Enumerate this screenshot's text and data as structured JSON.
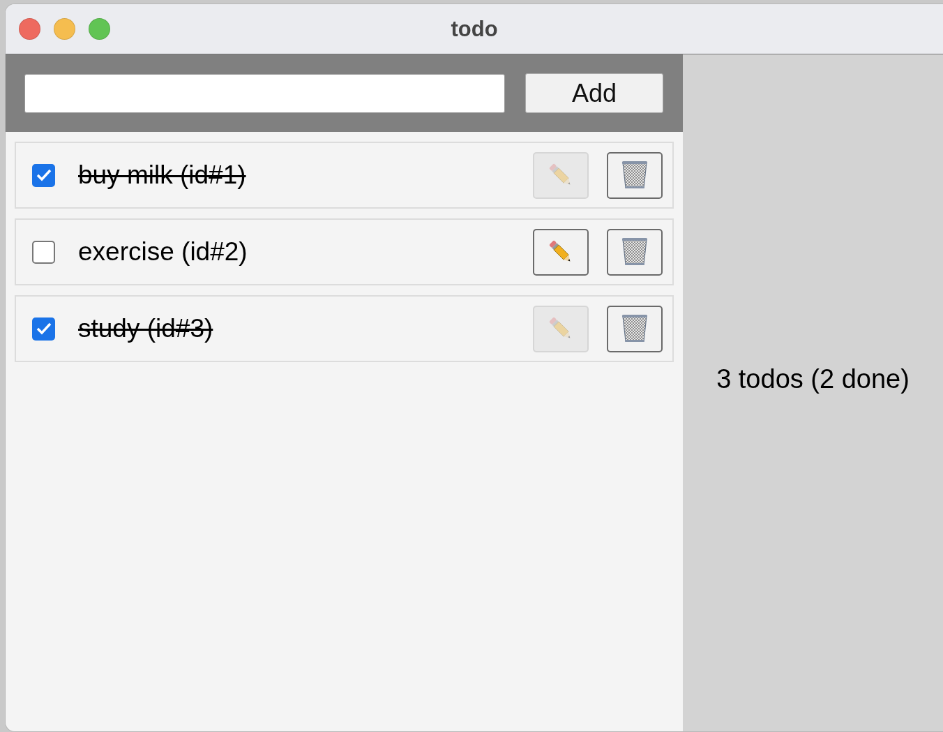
{
  "window": {
    "title": "todo"
  },
  "add_button": {
    "label": "Add"
  },
  "todos": [
    {
      "label": "buy milk (id#1)",
      "done": true,
      "edit_disabled": true
    },
    {
      "label": "exercise (id#2)",
      "done": false,
      "edit_disabled": false
    },
    {
      "label": "study (id#3)",
      "done": true,
      "edit_disabled": true
    }
  ],
  "summary": "3 todos (2 done)"
}
